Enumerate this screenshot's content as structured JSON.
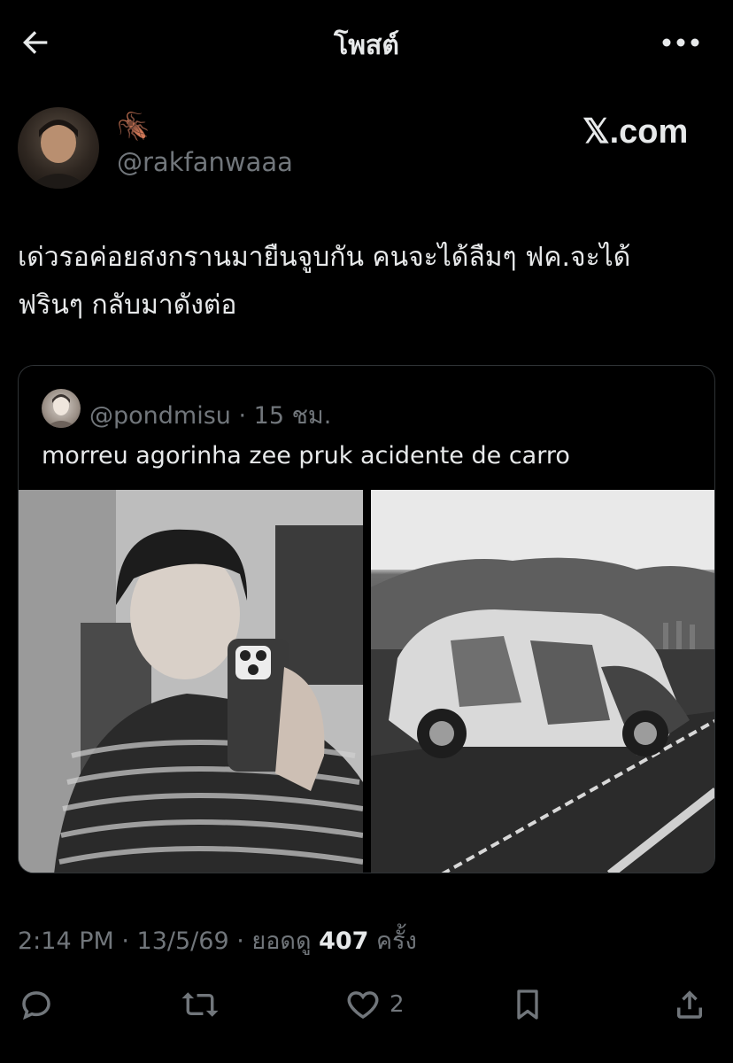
{
  "header": {
    "title": "โพสต์"
  },
  "author": {
    "display_name": "🪳",
    "handle": "@rakfanwaaa"
  },
  "watermark": "𝕏.com",
  "tweet": {
    "text_line1": "เด่วรอค่อยสงกรานมายืนจูบกัน คนจะได้ลืมๆ ฟค.จะได้",
    "text_line2": "ฟรินๆ กลับมาดังต่อ"
  },
  "quote": {
    "handle_time": "@pondmisu · 15 ชม.",
    "text": "morreu agorinha zee pruk acidente de carro"
  },
  "meta": {
    "time_date": "2:14 PM · 13/5/69 · ยอดดู ",
    "views": "407",
    "views_suffix": " ครั้ง"
  },
  "actions": {
    "like_count": "2"
  },
  "icons": {
    "back": "arrow-left-icon",
    "more": "more-horizontal-icon",
    "reply": "reply-icon",
    "repost": "repost-icon",
    "like": "heart-icon",
    "bookmark": "bookmark-icon",
    "share": "share-icon"
  }
}
